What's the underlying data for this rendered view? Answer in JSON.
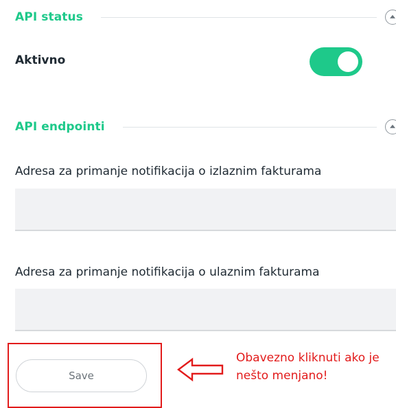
{
  "sections": {
    "api_status": {
      "title": "API status",
      "collapse_icon": "chevron-up-icon"
    },
    "api_endpoints": {
      "title": "API endpointi",
      "collapse_icon": "chevron-up-icon"
    }
  },
  "status": {
    "active_label": "Aktivno",
    "active_toggle_on": true
  },
  "fields": {
    "outgoing": {
      "label": "Adresa za primanje notifikacija o izlaznim fakturama",
      "value": ""
    },
    "incoming": {
      "label": "Adresa za primanje notifikacija o ulaznim fakturama",
      "value": ""
    }
  },
  "actions": {
    "save_label": "Save"
  },
  "annotation": {
    "line1": "Obavezno kliknuti ako je",
    "line2": "nešto menjano!",
    "arrow_icon": "arrow-left-icon"
  },
  "colors": {
    "accent": "#1ec98a",
    "annotation_red": "#e21b1b",
    "input_bg": "#f1f2f4"
  }
}
